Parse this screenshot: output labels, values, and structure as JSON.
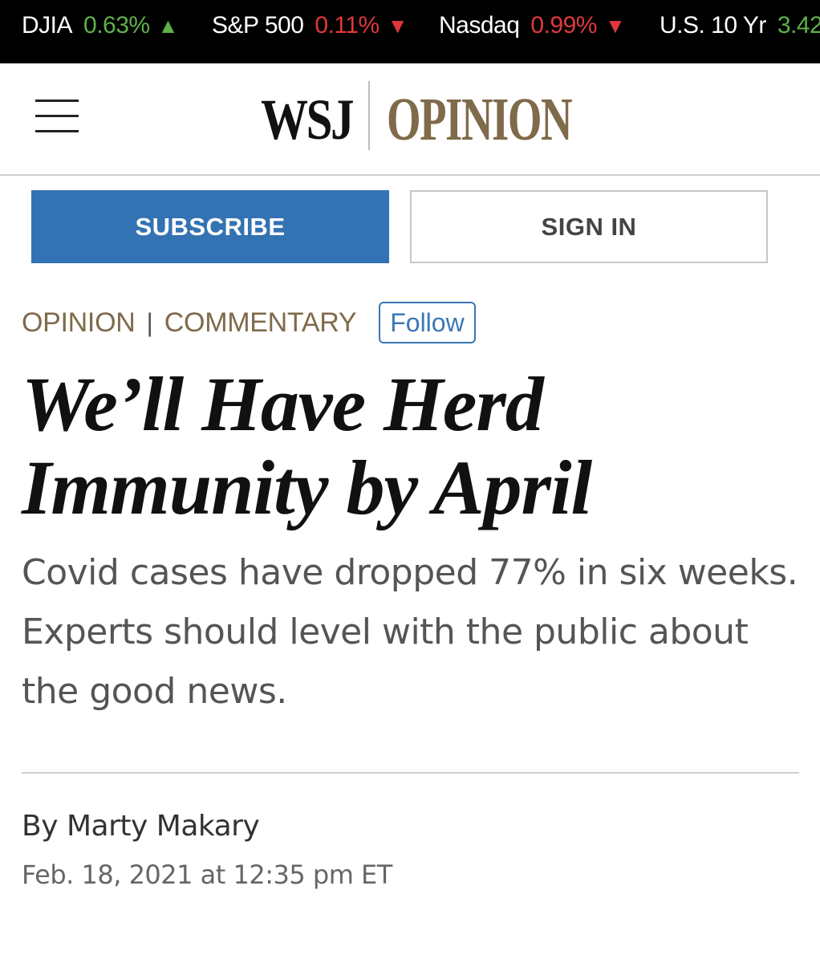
{
  "ticker": [
    {
      "name": "DJIA",
      "value": "0.63%",
      "direction": "up",
      "arrow": "▲"
    },
    {
      "name": "S&P 500",
      "value": "0.11%",
      "direction": "down",
      "arrow": "▼"
    },
    {
      "name": "Nasdaq",
      "value": "0.99%",
      "direction": "down",
      "arrow": "▼"
    },
    {
      "name": "U.S. 10 Yr",
      "value": "3.42",
      "direction": "up",
      "arrow": ""
    }
  ],
  "masthead": {
    "logo": "WSJ",
    "section": "OPINION",
    "menu_icon": "hamburger-menu-icon"
  },
  "actions": {
    "subscribe_label": "SUBSCRIBE",
    "signin_label": "SIGN IN"
  },
  "section": {
    "primary": "OPINION",
    "separator": "|",
    "secondary": "COMMENTARY",
    "follow_label": "Follow"
  },
  "article": {
    "headline_line1": "We’ll Have Herd",
    "headline_line2": "Immunity by April",
    "dek": "Covid cases have dropped 77% in six weeks. Experts should level with the public about the good news.",
    "byline_prefix": "By",
    "author": "Marty Makary",
    "timestamp": "Feb. 18, 2021 at 12:35 pm ET"
  },
  "colors": {
    "ticker_bg": "#000000",
    "up": "#5fb14a",
    "down": "#e0383b",
    "opinion_brand": "#7f6a4a",
    "subscribe_bg": "#3372b3",
    "follow_blue": "#3a78b5"
  }
}
